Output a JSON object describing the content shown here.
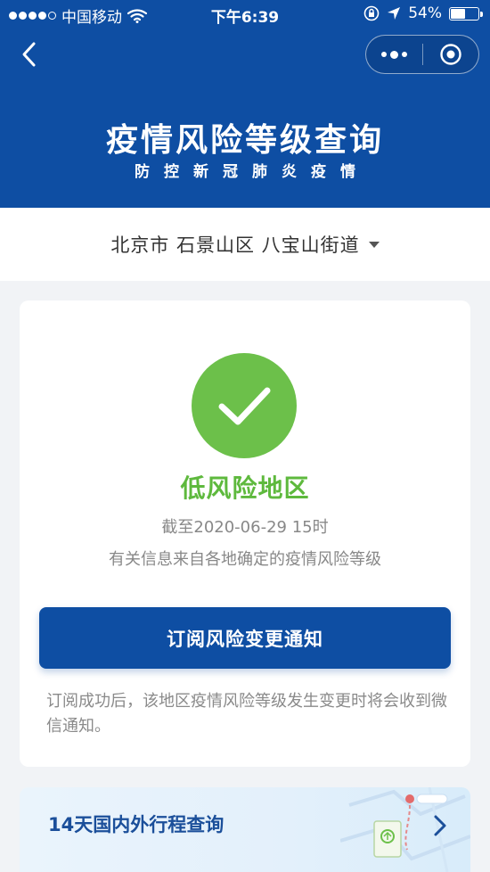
{
  "status_bar": {
    "carrier": "中国移动",
    "time": "下午6:39",
    "battery": "54%",
    "battery_level": 0.54
  },
  "header": {
    "title": "疫情风险等级查询",
    "subtitle": "防控新冠肺炎疫情",
    "background": "#0e4ea3"
  },
  "location": {
    "text": "北京市 石景山区 八宝山街道"
  },
  "result": {
    "risk_level": "低风险地区",
    "risk_color": "#5eb93d",
    "deadline": "截至2020-06-29 15时",
    "source": "有关信息来自各地确定的疫情风险等级",
    "status_icon": "check-icon"
  },
  "subscribe": {
    "label": "订阅风险变更通知",
    "note": "订阅成功后，该地区疫情风险等级发生变更时将会收到微信通知。"
  },
  "itinerary": {
    "label": "14天国内外行程查询"
  },
  "icons": {
    "back": "back-icon",
    "more": "more-icon",
    "close": "close-mini-program-icon",
    "wifi": "wifi-icon",
    "lock": "orientation-lock-icon",
    "location": "location-arrow-icon",
    "chevron": "chevron-right-icon"
  }
}
